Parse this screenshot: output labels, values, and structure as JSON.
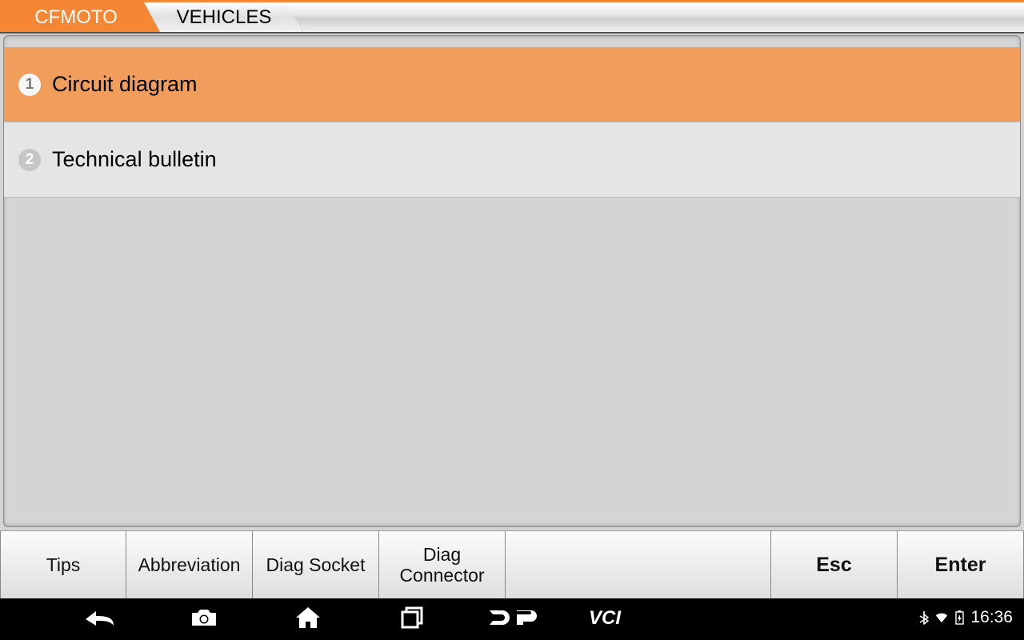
{
  "tabs": {
    "active": "CFMOTO",
    "inactive": "VEHICLES"
  },
  "menu": {
    "items": [
      {
        "num": "1",
        "label": "Circuit diagram",
        "selected": true
      },
      {
        "num": "2",
        "label": "Technical bulletin",
        "selected": false
      }
    ]
  },
  "buttons": {
    "tips": "Tips",
    "abbreviation": "Abbreviation",
    "diag_socket": "Diag Socket",
    "diag_connector": "Diag Connector",
    "esc": "Esc",
    "enter": "Enter"
  },
  "status": {
    "time": "16:36"
  }
}
